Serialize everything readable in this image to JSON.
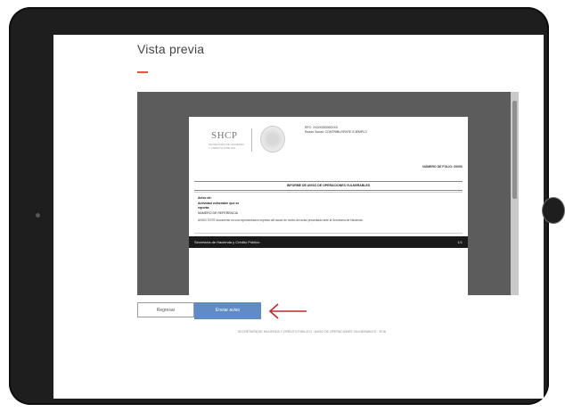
{
  "page": {
    "title": "Vista previa"
  },
  "document": {
    "logo_text": "SHCP",
    "logo_subtitle": "SECRETARÍA DE HACIENDA Y CRÉDITO PÚBLICO",
    "header_lines": [
      "RFC: XXXX000000XXX",
      "Razón Social: CONTRIBUYENTE EJEMPLO"
    ],
    "header_right": "NÚMERO DE FOLIO: 00000",
    "report_title": "INFORME DE AVISO DE OPERACIONES VULNERABLES",
    "section_lines": [
      "Aviso de:",
      "Actividad vulnerable que se",
      "reporta:",
      "NÚMERO DE REFERENCIA"
    ],
    "section_note": "AVISO: ESTE documento es una representación impresa del acuse de recibo del aviso presentado ante la Secretaría de Hacienda.",
    "footer_left": "Secretaría de Hacienda y Crédito Público",
    "footer_right": "1/1"
  },
  "buttons": {
    "back_label": "Regresar",
    "send_label": "Enviar aviso"
  },
  "footer": {
    "text": "SECRETARÍA DE HACIENDA Y CRÉDITO PÚBLICO · AVISO DE OPERACIONES VULNERABLES · 2016"
  },
  "icons": {
    "arrow": "arrow-left-icon",
    "seal": "seal-icon"
  },
  "colors": {
    "accent": "#e05a3a",
    "primary_button": "#5f8bc9",
    "arrow": "#c0282d"
  }
}
